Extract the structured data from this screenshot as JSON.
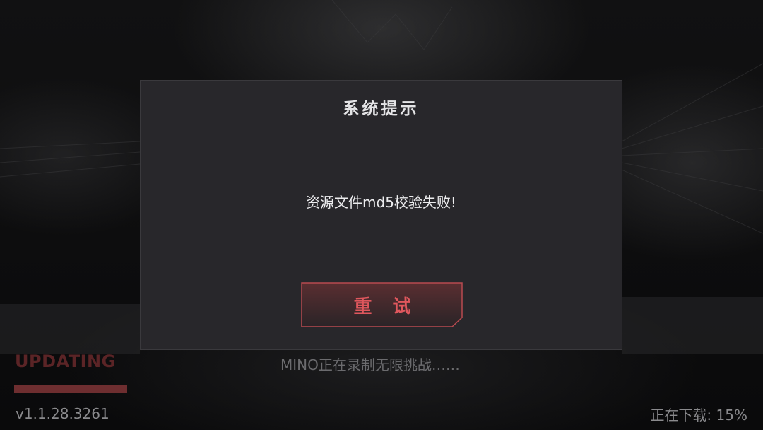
{
  "dialog": {
    "title": "系统提示",
    "message": "资源文件md5校验失败!",
    "retry_label": "重 试"
  },
  "loading": {
    "status_label": "UPDATING",
    "progress": 1.0,
    "tip": "MINO正在录制无限挑战……",
    "version": "v1.1.28.3261",
    "download_status": "正在下载: 15%"
  },
  "colors": {
    "dialog_bg": "#28272b",
    "accent_red": "#e0575d",
    "updating_red": "#5b2426"
  }
}
